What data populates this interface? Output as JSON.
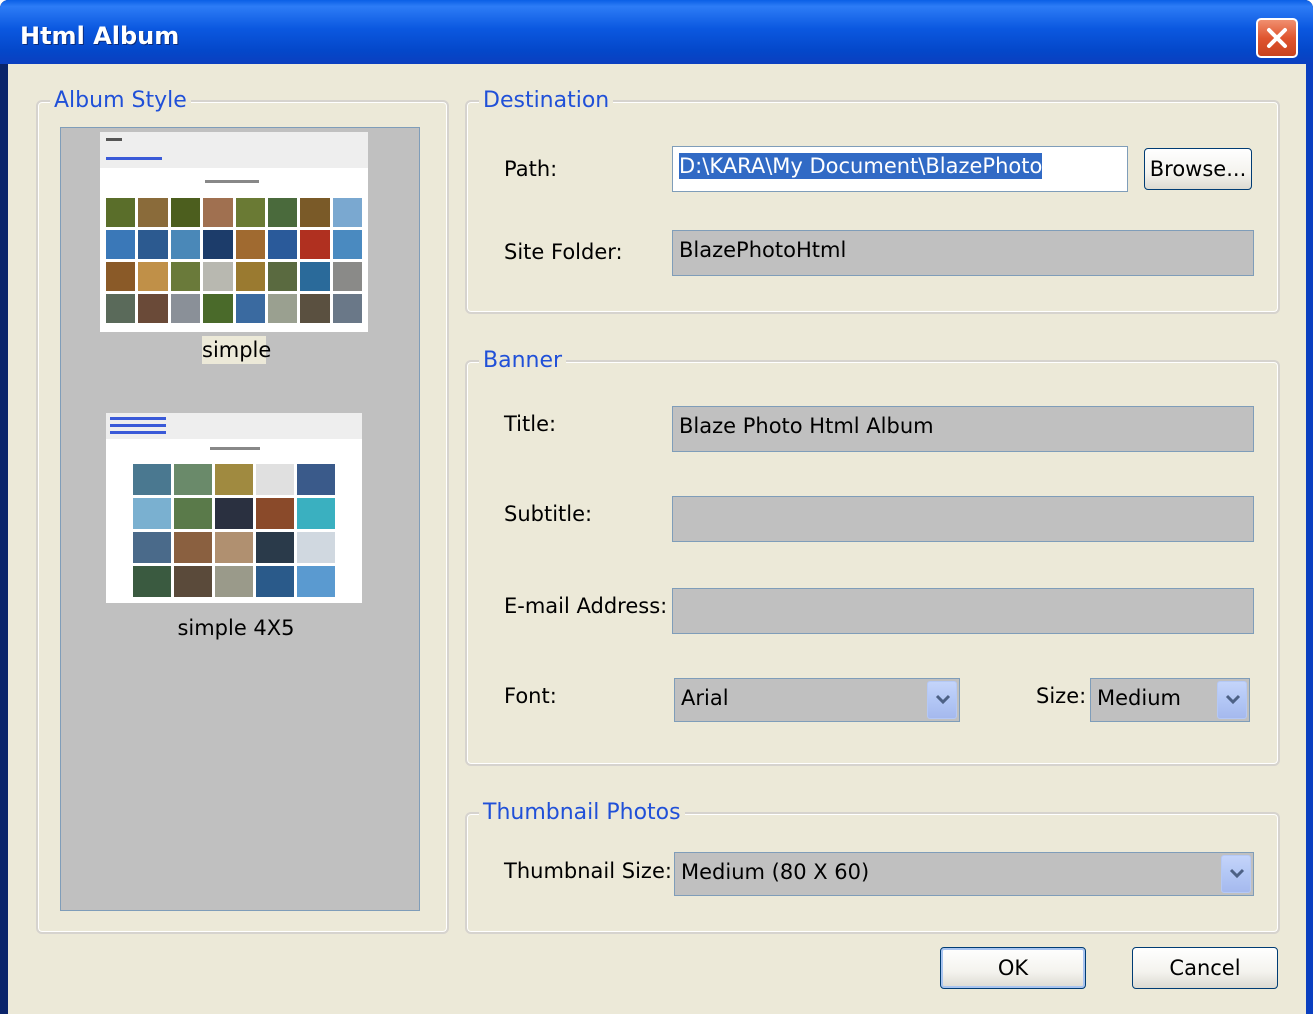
{
  "window": {
    "title": "Html Album"
  },
  "album_style": {
    "label": "Album Style",
    "styles": [
      {
        "name": "simple"
      },
      {
        "name": "simple 4X5"
      }
    ]
  },
  "destination": {
    "label": "Destination",
    "path_label": "Path:",
    "path_value": "D:\\KARA\\My Document\\BlazePhoto",
    "browse_label": "Browse...",
    "site_folder_label": "Site Folder:",
    "site_folder_value": "BlazePhotoHtml"
  },
  "banner": {
    "label": "Banner",
    "title_label": "Title:",
    "title_value": "Blaze Photo Html Album",
    "subtitle_label": "Subtitle:",
    "subtitle_value": "",
    "email_label": "E-mail Address:",
    "email_value": "",
    "font_label": "Font:",
    "font_value": "Arial",
    "size_label": "Size:",
    "size_value": "Medium"
  },
  "thumbnail": {
    "label": "Thumbnail Photos",
    "size_label": "Thumbnail Size:",
    "size_value": "Medium (80 X 60)"
  },
  "buttons": {
    "ok": "OK",
    "cancel": "Cancel"
  },
  "colors": {
    "title_bar": "#0b58e0",
    "dialog_bg": "#ece9d8",
    "group_label": "#2050d8",
    "field_bg": "#c0c0c0",
    "selection": "#316ac5"
  }
}
